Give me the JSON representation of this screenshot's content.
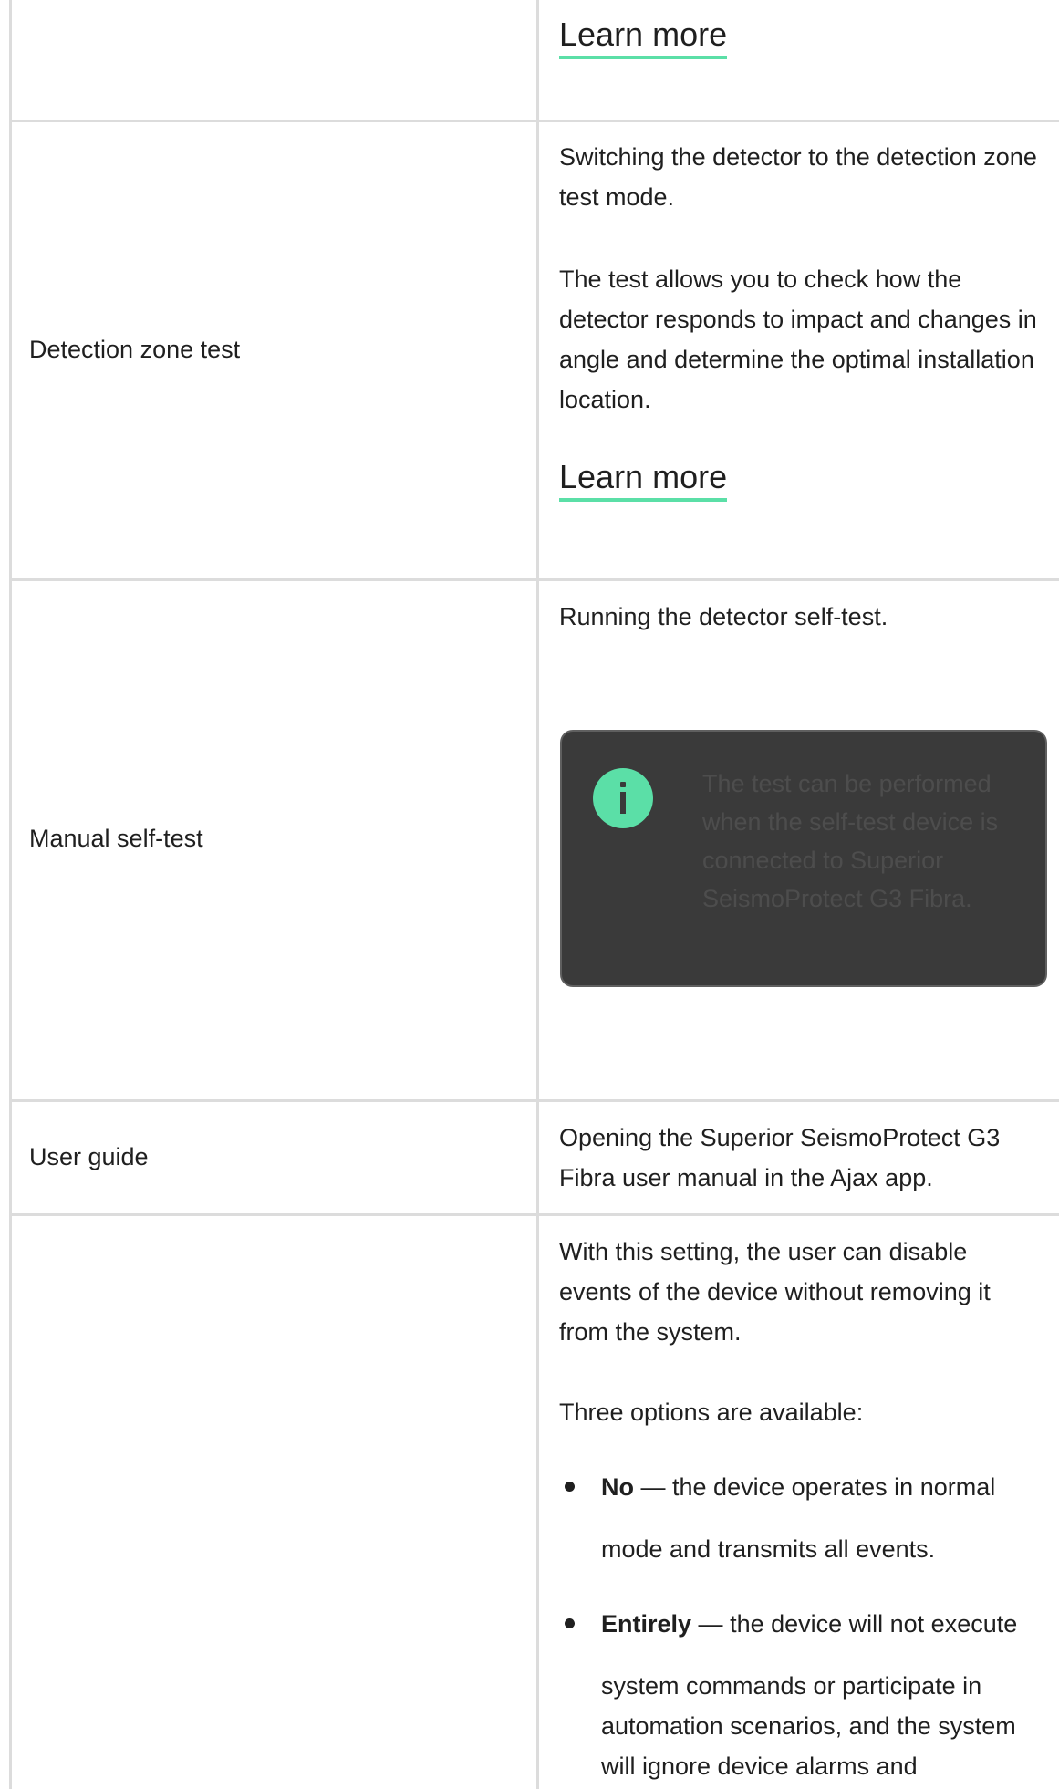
{
  "colors": {
    "accent": "#5bdfa7",
    "border": "#dcdcdc",
    "info_box_bg": "#3a3a3a",
    "info_text": "#4d4d4d"
  },
  "rows": [
    {
      "label": "",
      "learn_more": "Learn more"
    },
    {
      "label": "Detection zone test",
      "paragraphs": [
        "Switching the detector to the detection zone test mode.",
        "The test allows you to check how the detector responds to impact and changes in angle and determine the optimal installation location."
      ],
      "learn_more": "Learn more"
    },
    {
      "label": "Manual self-test",
      "paragraphs": [
        "Running the detector self-test."
      ],
      "info": {
        "icon": "info-icon",
        "text": "The test can be performed when the self-test device is connected to Superior SeismoProtect G3 Fibra."
      }
    },
    {
      "label": "User guide",
      "paragraphs": [
        "Opening the Superior SeismoProtect G3 Fibra user manual in the Ajax app."
      ]
    },
    {
      "label": "",
      "paragraphs": [
        "With this setting, the user can disable events of the device without removing it from the system.",
        "Three options are available:"
      ],
      "options": [
        {
          "name": "No",
          "separator": " — ",
          "line1": "the device operates in normal",
          "line2": "mode and transmits all events."
        },
        {
          "name": "Entirely",
          "separator": " — ",
          "line1": "the device will not execute",
          "line2": "system commands or participate in automation scenarios, and the system will ignore device alarms and"
        }
      ]
    }
  ]
}
